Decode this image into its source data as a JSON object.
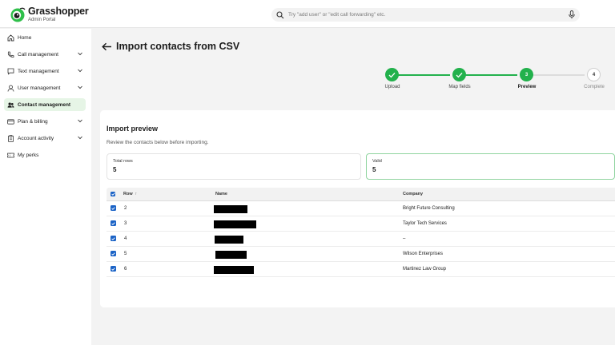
{
  "brand": {
    "name": "Grasshopper",
    "subtitle": "Admin Portal"
  },
  "search": {
    "placeholder": "Try \"add user\" or \"edit call forwarding\" etc."
  },
  "sidebar": {
    "items": [
      {
        "label": "Home",
        "icon": "home-icon",
        "has_chevron": false,
        "active": false
      },
      {
        "label": "Call management",
        "icon": "phone-icon",
        "has_chevron": true,
        "active": false
      },
      {
        "label": "Text management",
        "icon": "message-icon",
        "has_chevron": true,
        "active": false
      },
      {
        "label": "User management",
        "icon": "user-icon",
        "has_chevron": true,
        "active": false
      },
      {
        "label": "Contact management",
        "icon": "contacts-icon",
        "has_chevron": false,
        "active": true
      },
      {
        "label": "Plan & billing",
        "icon": "credit-card-icon",
        "has_chevron": true,
        "active": false
      },
      {
        "label": "Account activity",
        "icon": "clipboard-icon",
        "has_chevron": true,
        "active": false
      },
      {
        "label": "My perks",
        "icon": "ticket-icon",
        "has_chevron": false,
        "active": false
      }
    ]
  },
  "page": {
    "title": "Import contacts from CSV"
  },
  "stepper": {
    "steps": [
      {
        "label": "Upload",
        "state": "done",
        "number": "1"
      },
      {
        "label": "Map fields",
        "state": "done",
        "number": "2"
      },
      {
        "label": "Preview",
        "state": "current",
        "number": "3"
      },
      {
        "label": "Complete",
        "state": "todo",
        "number": "4"
      }
    ]
  },
  "preview": {
    "title": "Import preview",
    "subtitle": "Review the contacts below before importing.",
    "stats": [
      {
        "label": "Total rows",
        "value": "5"
      },
      {
        "label": "Valid",
        "value": "5"
      }
    ],
    "columns": {
      "row": "Row",
      "name": "Name",
      "company": "Company"
    },
    "rows": [
      {
        "row": "2",
        "company": "Bright Future Consulting",
        "checked": true
      },
      {
        "row": "3",
        "company": "Taylor Tech Services",
        "checked": true
      },
      {
        "row": "4",
        "company": "–",
        "checked": true
      },
      {
        "row": "5",
        "company": "Wilson Enterprises",
        "checked": true
      },
      {
        "row": "6",
        "company": "Martinez Law Group",
        "checked": true
      }
    ]
  },
  "colors": {
    "accent": "#22b14c",
    "checkbox": "#1b63c6",
    "active_nav_bg": "#e6f5e6"
  }
}
